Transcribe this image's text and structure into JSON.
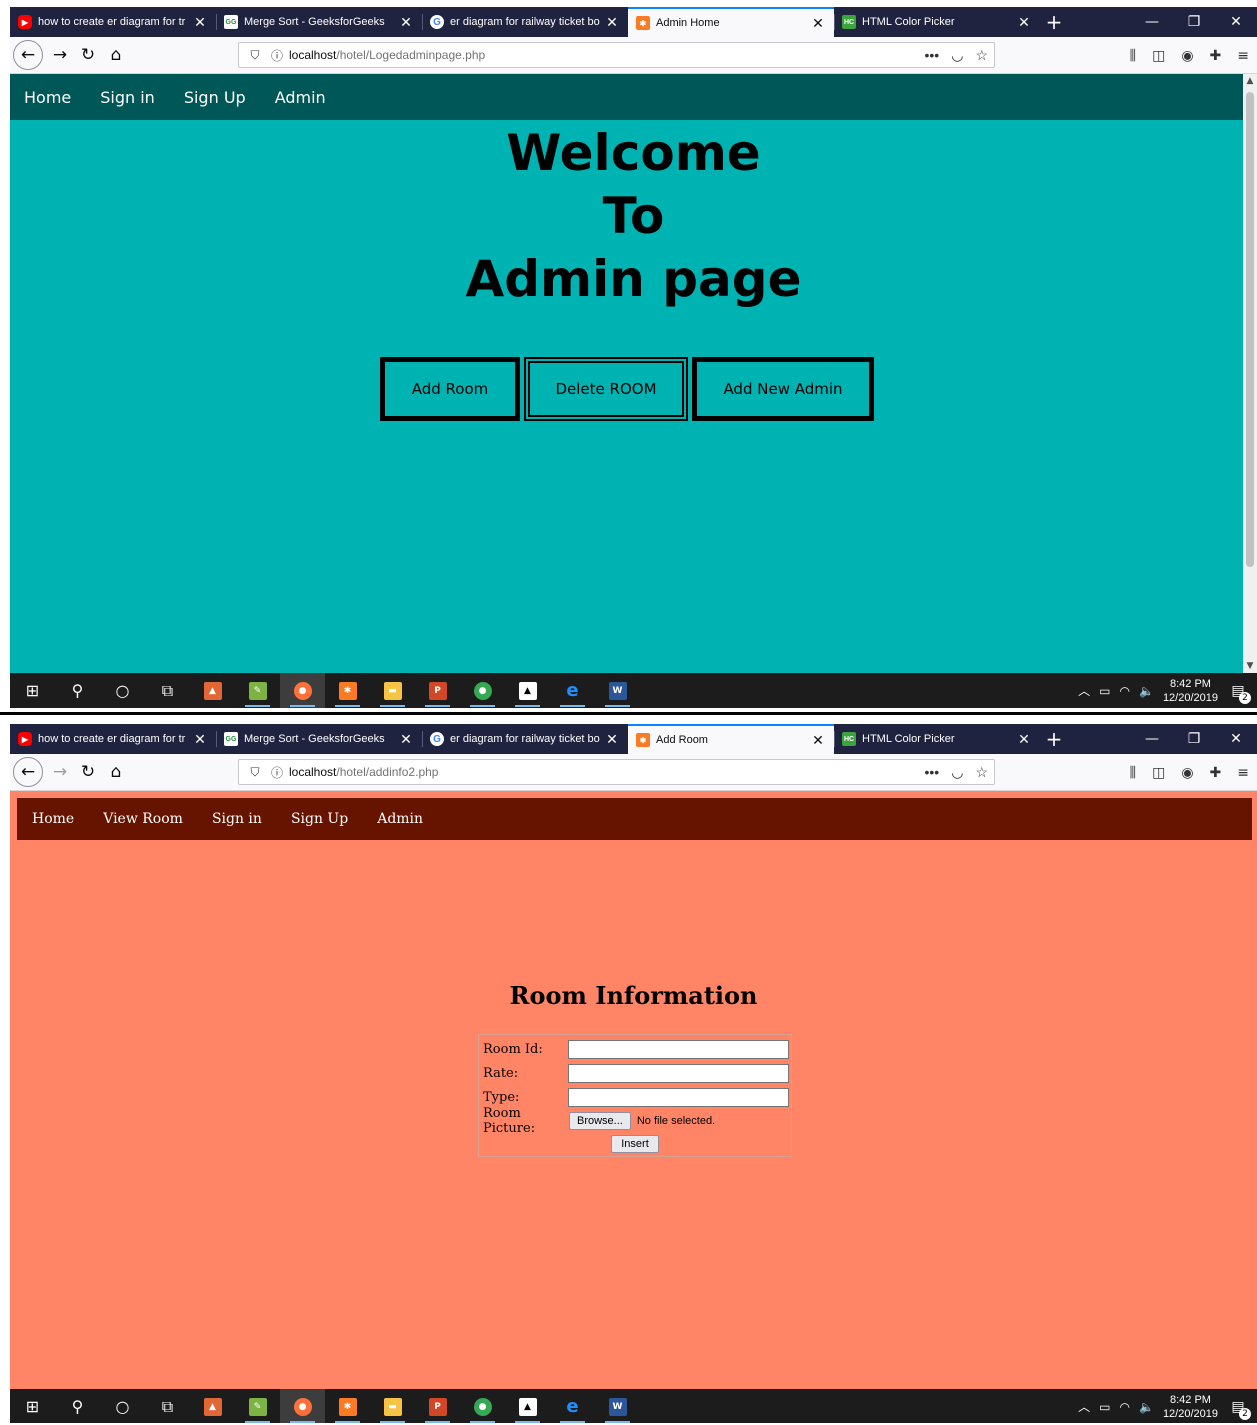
{
  "browser": {
    "tabs": [
      {
        "title": "how to create er diagram for tr",
        "icon": "youtube-icon"
      },
      {
        "title": "Merge Sort - GeeksforGeeks",
        "icon": "gfg-icon"
      },
      {
        "title": "er diagram for railway ticket bo",
        "icon": "google-icon"
      },
      {
        "title": "HTML Color Picker",
        "icon": "color-picker-icon"
      }
    ],
    "close_glyph": "✕",
    "newtab_glyph": "+",
    "url_host": "localhost"
  },
  "shot1": {
    "active_tab_title": "Admin Home",
    "url_path": "/hotel/Logedadminpage.php",
    "nav": [
      "Home",
      "Sign in",
      "Sign Up",
      "Admin"
    ],
    "welcome_lines": [
      "Welcome",
      "To",
      "Admin page"
    ],
    "buttons": [
      "Add Room",
      "Delete ROOM",
      "Add New Admin"
    ],
    "bg_color": "#00b3b3",
    "nav_color": "#005757"
  },
  "shot2": {
    "active_tab_title": "Add Room",
    "url_path": "/hotel/addinfo2.php",
    "nav": [
      "Home",
      "View Room",
      "Sign in",
      "Sign Up",
      "Admin"
    ],
    "heading": "Room Information",
    "fields": [
      {
        "label": "Room Id:",
        "value": ""
      },
      {
        "label": "Rate:",
        "value": ""
      },
      {
        "label": "Type:",
        "value": ""
      }
    ],
    "picture_label": "Room Picture:",
    "browse_label": "Browse...",
    "no_file_text": "No file selected.",
    "insert_label": "Insert",
    "bg_color": "#ff8566",
    "nav_color": "#661400"
  },
  "taskbar": {
    "time": "8:42 PM",
    "date": "12/20/2019",
    "notification_count": "2"
  }
}
